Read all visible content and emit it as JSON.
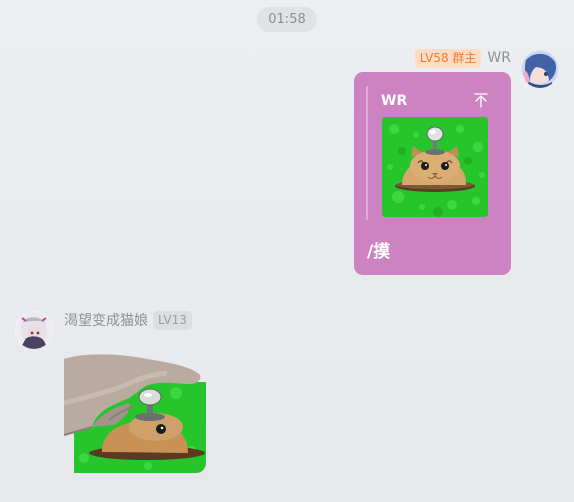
{
  "timestamp": "01:58",
  "messages": [
    {
      "side": "right",
      "sender": "WR",
      "badge_level": "LV58",
      "badge_role": "群主",
      "badge_text": "LV58 群主",
      "quote": {
        "author": "WR",
        "content": "image: cat with lever sticker"
      },
      "text": "/摸",
      "colors": {
        "bubble": "#cd82c1",
        "badge_bg": "#fddcc4",
        "badge_fg": "#ef7e35"
      }
    },
    {
      "side": "left",
      "sender": "渴望变成猫娘",
      "badge_level": "LV13",
      "content": "image: hand petting cat sticker"
    }
  ]
}
